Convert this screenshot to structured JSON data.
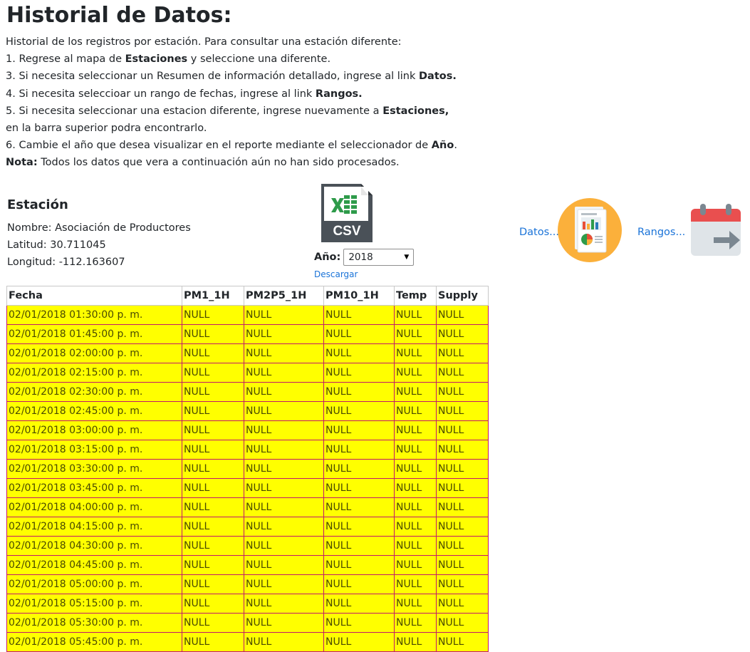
{
  "page": {
    "title": "Historial de Datos:",
    "intro": [
      {
        "text": "Historial de los registros por estación. Para consultar una estación diferente:",
        "bold": "",
        "after": ""
      },
      {
        "text": "1. Regrese al mapa de ",
        "bold": "Estaciones",
        "after": " y seleccione una diferente."
      },
      {
        "text": "3. Si necesita seleccionar un Resumen de información detallado, ingrese al link ",
        "bold": "Datos.",
        "after": ""
      },
      {
        "text": "4. Si necesita seleccioar un rango de fechas, ingrese al link ",
        "bold": "Rangos.",
        "after": ""
      },
      {
        "text": "5. Si necesita seleccionar una estacion diferente, ingrese nuevamente a ",
        "bold": "Estaciones,",
        "after": ""
      },
      {
        "text": "en la barra superior podra encontrarlo.",
        "bold": "",
        "after": ""
      },
      {
        "text": "6. Cambie el año que desea visualizar en el reporte mediante el seleccionador de ",
        "bold": "Año",
        "after": "."
      },
      {
        "text": "",
        "bold": "Nota:",
        "after": " Todos los datos que vera a continuación aún no han sido procesados."
      }
    ]
  },
  "station": {
    "heading": "Estación",
    "name": "Nombre: Asociación de Productores",
    "lat": "Latitud: 30.711045",
    "lon": "Longitud: -112.163607"
  },
  "controls": {
    "csv_icon": "csv-file-icon",
    "csv_text": "CSV",
    "year_label": "Año:",
    "year_value": "2018",
    "download_label": "Descargar",
    "datos_label": "Datos...",
    "datos_icon": "report-icon",
    "rangos_label": "Rangos...",
    "rangos_icon": "calendar-arrow-icon"
  },
  "colors": {
    "row_bg": "#ffff00",
    "row_border": "#c2186b",
    "link": "#1a73d8",
    "accent_orange": "#fbb03b"
  },
  "table": {
    "headers": [
      "Fecha",
      "PM1_1H",
      "PM2P5_1H",
      "PM10_1H",
      "Temp",
      "Supply"
    ],
    "rows": [
      [
        "02/01/2018 01:30:00 p. m.",
        "NULL",
        "NULL",
        "NULL",
        "NULL",
        "NULL"
      ],
      [
        "02/01/2018 01:45:00 p. m.",
        "NULL",
        "NULL",
        "NULL",
        "NULL",
        "NULL"
      ],
      [
        "02/01/2018 02:00:00 p. m.",
        "NULL",
        "NULL",
        "NULL",
        "NULL",
        "NULL"
      ],
      [
        "02/01/2018 02:15:00 p. m.",
        "NULL",
        "NULL",
        "NULL",
        "NULL",
        "NULL"
      ],
      [
        "02/01/2018 02:30:00 p. m.",
        "NULL",
        "NULL",
        "NULL",
        "NULL",
        "NULL"
      ],
      [
        "02/01/2018 02:45:00 p. m.",
        "NULL",
        "NULL",
        "NULL",
        "NULL",
        "NULL"
      ],
      [
        "02/01/2018 03:00:00 p. m.",
        "NULL",
        "NULL",
        "NULL",
        "NULL",
        "NULL"
      ],
      [
        "02/01/2018 03:15:00 p. m.",
        "NULL",
        "NULL",
        "NULL",
        "NULL",
        "NULL"
      ],
      [
        "02/01/2018 03:30:00 p. m.",
        "NULL",
        "NULL",
        "NULL",
        "NULL",
        "NULL"
      ],
      [
        "02/01/2018 03:45:00 p. m.",
        "NULL",
        "NULL",
        "NULL",
        "NULL",
        "NULL"
      ],
      [
        "02/01/2018 04:00:00 p. m.",
        "NULL",
        "NULL",
        "NULL",
        "NULL",
        "NULL"
      ],
      [
        "02/01/2018 04:15:00 p. m.",
        "NULL",
        "NULL",
        "NULL",
        "NULL",
        "NULL"
      ],
      [
        "02/01/2018 04:30:00 p. m.",
        "NULL",
        "NULL",
        "NULL",
        "NULL",
        "NULL"
      ],
      [
        "02/01/2018 04:45:00 p. m.",
        "NULL",
        "NULL",
        "NULL",
        "NULL",
        "NULL"
      ],
      [
        "02/01/2018 05:00:00 p. m.",
        "NULL",
        "NULL",
        "NULL",
        "NULL",
        "NULL"
      ],
      [
        "02/01/2018 05:15:00 p. m.",
        "NULL",
        "NULL",
        "NULL",
        "NULL",
        "NULL"
      ],
      [
        "02/01/2018 05:30:00 p. m.",
        "NULL",
        "NULL",
        "NULL",
        "NULL",
        "NULL"
      ],
      [
        "02/01/2018 05:45:00 p. m.",
        "NULL",
        "NULL",
        "NULL",
        "NULL",
        "NULL"
      ]
    ]
  }
}
